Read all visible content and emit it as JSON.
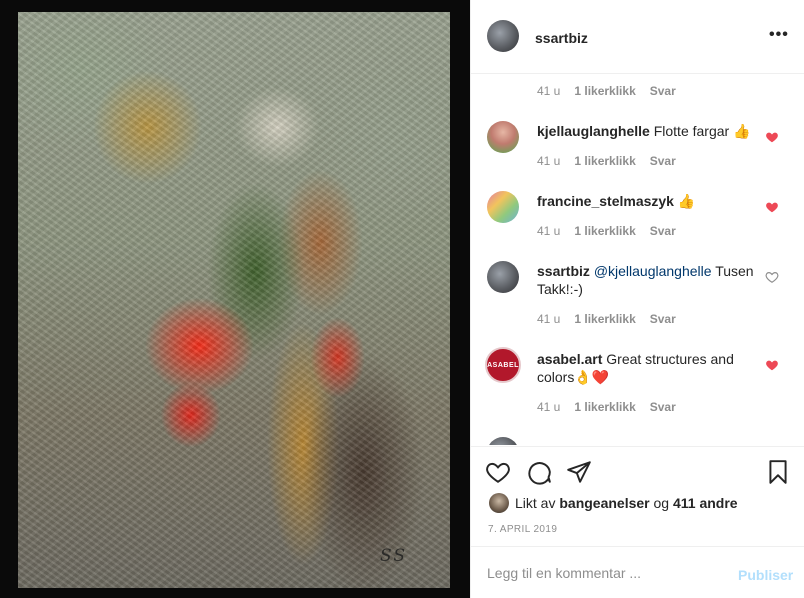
{
  "post": {
    "username": "ssartbiz",
    "more_label": "•••",
    "signature": "SS"
  },
  "comments": [
    {
      "text": "",
      "time": "41 u",
      "likes": "1 likerklikk",
      "reply": "Svar"
    },
    {
      "user": "kjellauglanghelle",
      "text": "Flotte fargar 👍",
      "time": "41 u",
      "likes": "1 likerklikk",
      "reply": "Svar",
      "liked": true
    },
    {
      "user": "francine_stelmaszyk",
      "text": "👍",
      "time": "41 u",
      "likes": "1 likerklikk",
      "reply": "Svar",
      "liked": true
    },
    {
      "user": "ssartbiz",
      "mention": "@kjellauglanghelle",
      "text": "Tusen Takk!:-)",
      "time": "41 u",
      "likes": "1 likerklikk",
      "reply": "Svar",
      "liked": false
    },
    {
      "user": "asabel.art",
      "text": "Great structures and colors👌❤️",
      "time": "41 u",
      "likes": "1 likerklikk",
      "reply": "Svar",
      "liked": true,
      "avatar_text": "ASABEL"
    }
  ],
  "likes": {
    "prefix": "Likt av",
    "user": "bangeanelser",
    "joiner": "og",
    "others": "411 andre"
  },
  "date": "7. APRIL 2019",
  "comment_box": {
    "placeholder": "Legg til en kommentar ...",
    "publish_label": "Publiser"
  },
  "colors": {
    "heart_red": "#ed4956",
    "mention_blue": "#00376b",
    "publish_disabled": "#b2dffc"
  }
}
